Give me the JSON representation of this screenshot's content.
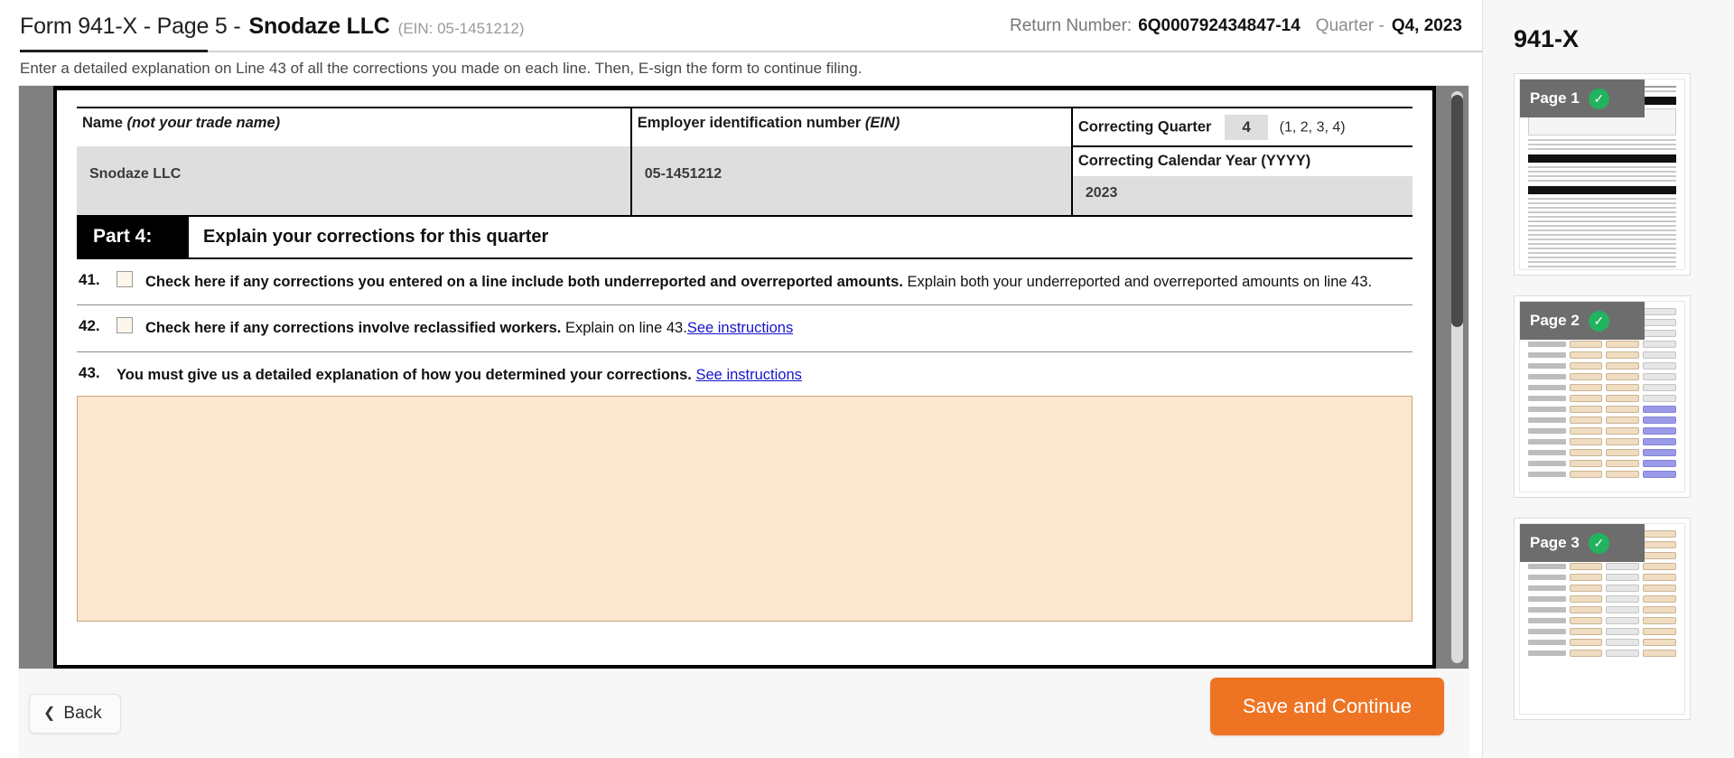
{
  "header": {
    "title": "Form 941-X - Page 5 - ",
    "company": "Snodaze LLC",
    "ein": "(EIN: 05-1451212)",
    "return_label": "Return Number:",
    "return_number": "6Q000792434847-14",
    "quarter_label": "Quarter -",
    "quarter_value": "Q4, 2023",
    "subtitle": "Enter a detailed explanation on Line 43 of all the corrections you made on each line. Then, E-sign the form to continue filing.",
    "expand_icon": "compress-icon"
  },
  "form": {
    "name_label": "Name",
    "name_label_italic": "(not your trade name)",
    "name_value": "Snodaze LLC",
    "ein_label": "Employer identification number",
    "ein_label_italic": "(EIN)",
    "ein_value": "05-1451212",
    "quarter_label": "Correcting Quarter",
    "quarter_value": "4",
    "quarter_hint": "(1, 2, 3, 4)",
    "year_label": "Correcting Calendar Year (YYYY)",
    "year_value": "2023",
    "part_tag": "Part 4:",
    "part_desc": "Explain your corrections for this quarter",
    "lines": [
      {
        "number": "41.",
        "has_checkbox": true,
        "checked": false,
        "bold_text": "Check here if any corrections you entered on a line include both underreported and overreported amounts.",
        "regular_text": " Explain both your underreported and overreported amounts on line 43.",
        "link_text": ""
      },
      {
        "number": "42.",
        "has_checkbox": true,
        "checked": false,
        "bold_text": "Check here if any corrections involve reclassified workers.",
        "regular_text": " Explain on line 43.",
        "link_text": "See instructions"
      },
      {
        "number": "43.",
        "has_checkbox": false,
        "checked": false,
        "bold_text": "You must give us a detailed explanation of how you determined your corrections.",
        "regular_text": " ",
        "link_text": "See instructions"
      }
    ],
    "explanation_value": "",
    "explanation_placeholder": ""
  },
  "footer": {
    "back_label": "Back",
    "back_icon": "chevron-left-icon",
    "save_label": "Save and Continue",
    "accent_color": "#ee7424"
  },
  "sidebar": {
    "title": "941-X",
    "check_icon": "check-circle-icon",
    "pages": [
      {
        "label": "Page 1",
        "completed": true
      },
      {
        "label": "Page 2",
        "completed": true
      },
      {
        "label": "Page 3",
        "completed": true
      }
    ]
  },
  "scrollbar": {
    "orientation": "vertical",
    "thumb_position_percent": 2
  }
}
